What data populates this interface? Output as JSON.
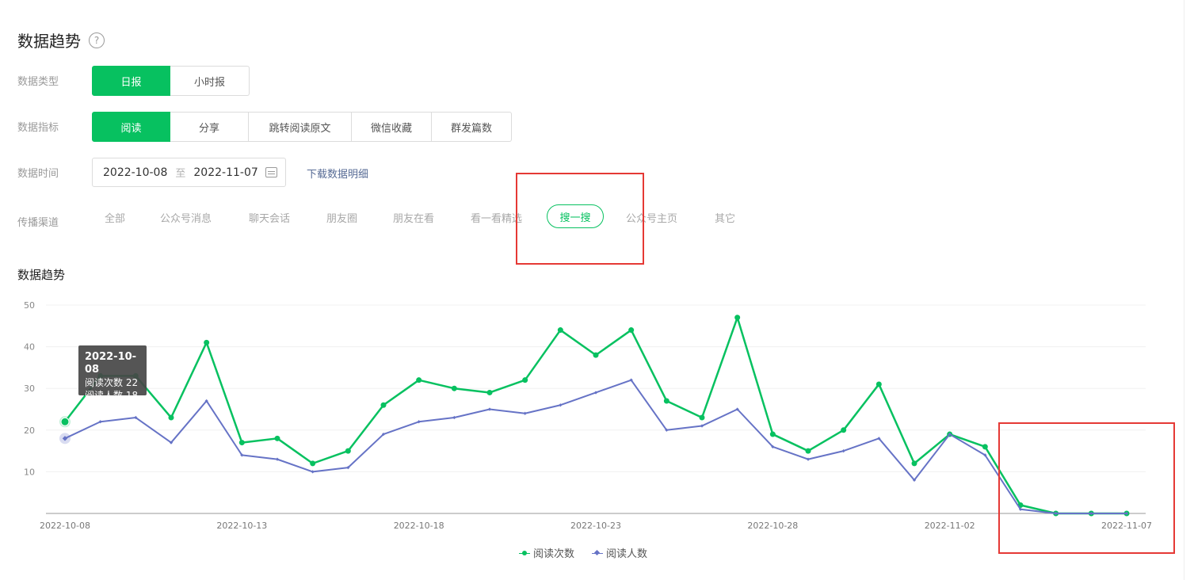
{
  "header": {
    "title": "数据趋势"
  },
  "filters": {
    "data_type": {
      "label": "数据类型",
      "options": [
        "日报",
        "小时报"
      ],
      "selected": 0
    },
    "metric": {
      "label": "数据指标",
      "options": [
        "阅读",
        "分享",
        "跳转阅读原文",
        "微信收藏",
        "群发篇数"
      ],
      "selected": 0
    },
    "time": {
      "label": "数据时间",
      "start": "2022-10-08",
      "separator": "至",
      "end": "2022-11-07",
      "download_label": "下载数据明细"
    },
    "channel": {
      "label": "传播渠道",
      "options": [
        "全部",
        "公众号消息",
        "聊天会话",
        "朋友圈",
        "朋友在看",
        "看一看精选",
        "搜一搜",
        "公众号主页",
        "其它"
      ],
      "selected": 6
    }
  },
  "chart_section": {
    "title": "数据趋势"
  },
  "tooltip": {
    "date": "2022-10-08",
    "line1": "阅读次数 22",
    "line2": "阅读人数 18"
  },
  "colors": {
    "accent": "#07c160",
    "series_reads": "#07c160",
    "series_readers": "#6673c6",
    "highlight_box": "#e53935",
    "link": "#576b95"
  },
  "chart_data": {
    "type": "line",
    "ylim": [
      0,
      50
    ],
    "yticks": [
      10,
      20,
      30,
      40,
      50
    ],
    "x": [
      "2022-10-08",
      "2022-10-09",
      "2022-10-10",
      "2022-10-11",
      "2022-10-12",
      "2022-10-13",
      "2022-10-14",
      "2022-10-15",
      "2022-10-16",
      "2022-10-17",
      "2022-10-18",
      "2022-10-19",
      "2022-10-20",
      "2022-10-21",
      "2022-10-22",
      "2022-10-23",
      "2022-10-24",
      "2022-10-25",
      "2022-10-26",
      "2022-10-27",
      "2022-10-28",
      "2022-10-29",
      "2022-10-30",
      "2022-10-31",
      "2022-11-01",
      "2022-11-02",
      "2022-11-03",
      "2022-11-04",
      "2022-11-05",
      "2022-11-06",
      "2022-11-07"
    ],
    "xtick_labels": [
      "2022-10-08",
      "2022-10-13",
      "2022-10-18",
      "2022-10-23",
      "2022-10-28",
      "2022-11-02",
      "2022-11-07"
    ],
    "legend_position": "bottom-center",
    "grid": true,
    "series": [
      {
        "name": "阅读次数",
        "values": [
          22,
          33,
          33,
          23,
          41,
          17,
          18,
          12,
          15,
          26,
          32,
          30,
          29,
          32,
          44,
          38,
          44,
          27,
          23,
          47,
          19,
          15,
          20,
          31,
          12,
          19,
          16,
          2,
          0,
          0,
          0
        ]
      },
      {
        "name": "阅读人数",
        "values": [
          18,
          22,
          23,
          17,
          27,
          14,
          13,
          10,
          11,
          19,
          22,
          23,
          25,
          24,
          26,
          29,
          32,
          20,
          21,
          25,
          16,
          13,
          15,
          18,
          8,
          19,
          14,
          1,
          0,
          0,
          0
        ]
      }
    ]
  }
}
